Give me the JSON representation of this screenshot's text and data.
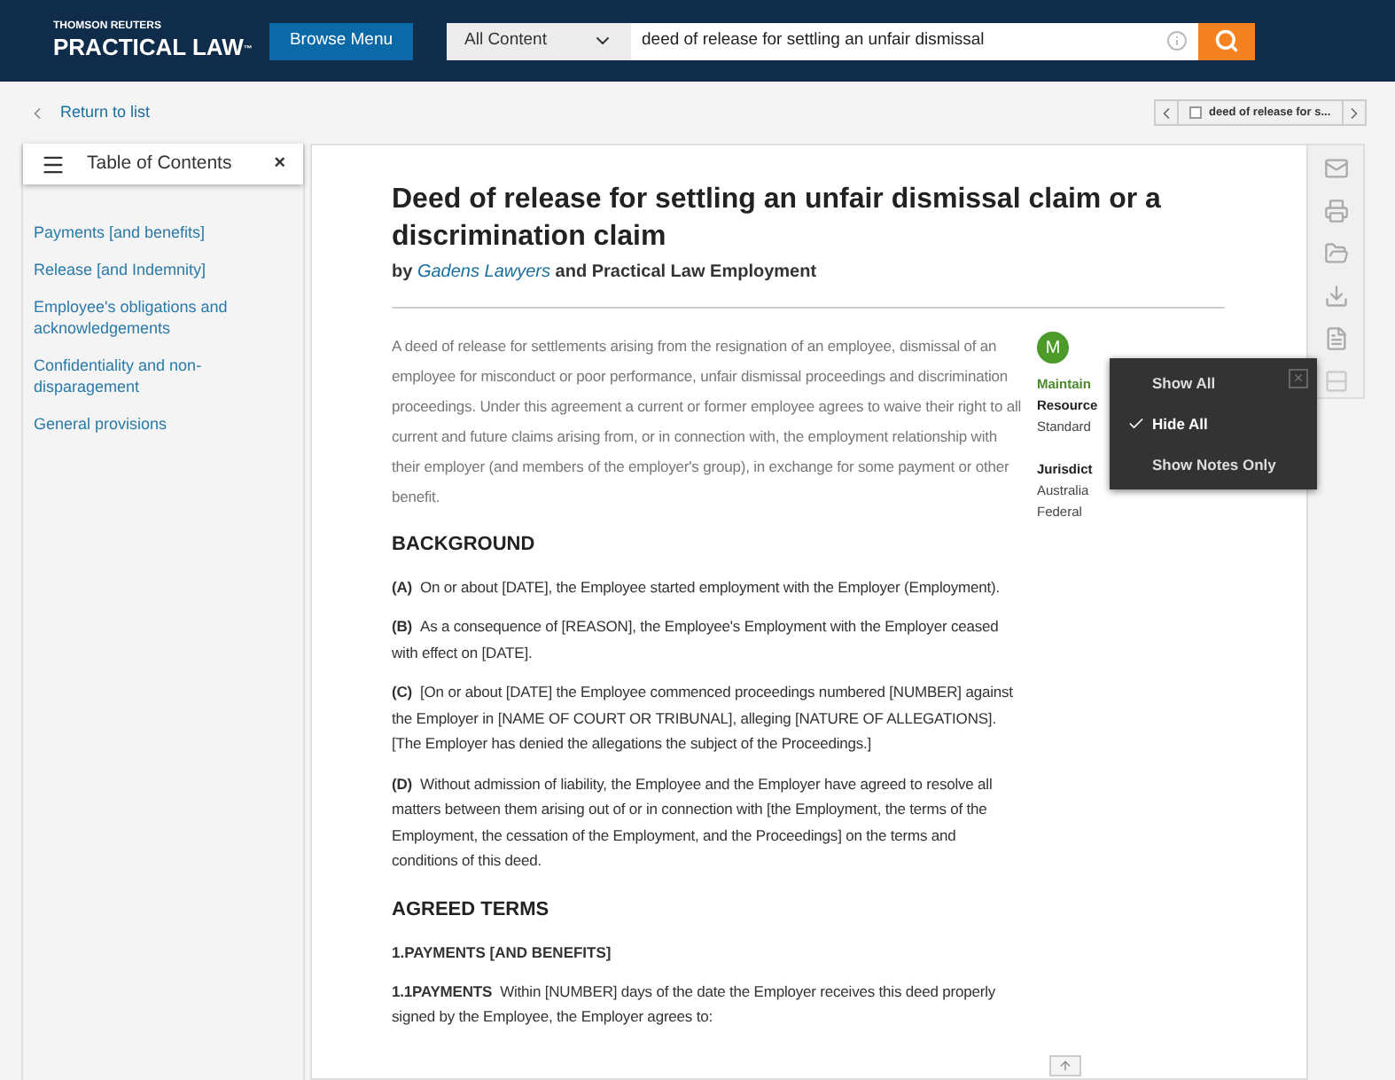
{
  "header": {
    "brand_top": "THOMSON REUTERS",
    "brand_main": "PRACTICAL LAW",
    "brand_mark": "™",
    "browse_button": "Browse Menu",
    "search": {
      "scope": "All Content",
      "value": "deed of release for settling an unfair dismissal"
    }
  },
  "subbar": {
    "back_link": "Return to list",
    "doc_nav": {
      "label": "deed of release for s...",
      "checked": false
    }
  },
  "toc": {
    "title": "Table of Contents",
    "close": "×",
    "items": [
      {
        "label": "Payments [and benefits]"
      },
      {
        "label": "Release [and Indemnity]"
      },
      {
        "label": "Employee's obligations and acknowledgements"
      },
      {
        "label": "Confidentiality and non-disparagement"
      },
      {
        "label": "General provisions"
      }
    ]
  },
  "document": {
    "title": "Deed of release for settling an unfair dismissal claim or a discrimination claim",
    "byline": {
      "prefix": "by",
      "author": "Gadens Lawyers",
      "suffix": "and Practical Law Employment"
    },
    "abstract": "A deed of release for settlements arising from the resignation of an employee, dismissal of an employee for misconduct or poor performance, unfair dismissal proceedings and discrimination proceedings. Under this agreement a current or former employee agrees to waive their right to all current and future claims arising from, or in connection with, the employment relationship with their employer (and members of the employer's group), in exchange for some payment or other benefit.",
    "blocks": [
      {
        "kind": "section",
        "text": "BACKGROUND"
      },
      {
        "kind": "para",
        "label": "(A)",
        "text": "On or about [DATE], the Employee started employment with the Employer (Employment)."
      },
      {
        "kind": "para",
        "label": "(B)",
        "text": "As a consequence of [REASON], the Employee's Employment with the Employer ceased with effect on [DATE]."
      },
      {
        "kind": "para",
        "label": "(C)",
        "text": "[On or about [DATE] the Employee commenced proceedings numbered [NUMBER] against the Employer in [NAME OF COURT OR TRIBUNAL], alleging [NATURE OF ALLEGATIONS]. [The Employer has denied the allegations the subject of the Proceedings.]"
      },
      {
        "kind": "para",
        "label": "(D)",
        "text": "Without admission of liability, the Employee and the Employer have agreed to resolve all matters between them arising out of or in connection with [the Employment, the terms of the Employment, the cessation of the Employment, and the Proceedings] on the terms and conditions of this deed."
      },
      {
        "kind": "section",
        "text": "AGREED TERMS"
      },
      {
        "kind": "subheading",
        "text": "1.PAYMENTS [AND BENEFITS]"
      },
      {
        "kind": "para",
        "label": "1.1PAYMENTS",
        "text": "Within [NUMBER] days of the date the Employer receives this deed properly signed by the Employee, the Employer agrees to:"
      }
    ]
  },
  "metadata": {
    "initial": "M",
    "lines": [
      {
        "kind": "status",
        "text": "Maintain"
      },
      {
        "kind": "bold",
        "text": "Resource"
      },
      {
        "kind": "plain",
        "text": "Standard"
      },
      {
        "kind": "gap"
      },
      {
        "kind": "bold",
        "text": "Jurisdict"
      },
      {
        "kind": "plain",
        "text": "Australia"
      },
      {
        "kind": "plain",
        "text": "Federal"
      }
    ]
  },
  "notes_menu": {
    "close": "×",
    "items": [
      {
        "label": "Show All",
        "selected": false
      },
      {
        "label": "Hide All",
        "selected": true
      },
      {
        "label": "Show Notes Only",
        "selected": false
      }
    ]
  }
}
